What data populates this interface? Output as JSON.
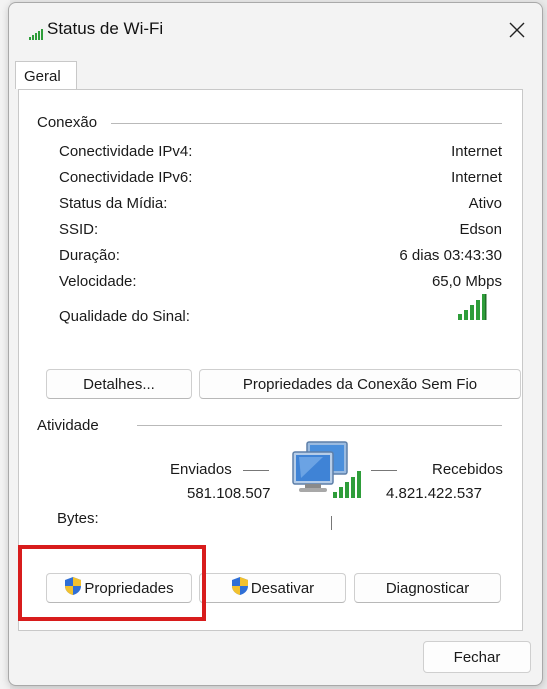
{
  "window": {
    "title": "Status de Wi-Fi",
    "tab": "Geral"
  },
  "connection": {
    "group_label": "Conexão",
    "rows": [
      {
        "label": "Conectividade IPv4:",
        "value": "Internet"
      },
      {
        "label": "Conectividade IPv6:",
        "value": "Internet"
      },
      {
        "label": "Status da Mídia:",
        "value": "Ativo"
      },
      {
        "label": "SSID:",
        "value": "Edson"
      },
      {
        "label": "Duração:",
        "value": "6 dias 03:43:30"
      },
      {
        "label": "Velocidade:",
        "value": "65,0 Mbps"
      }
    ],
    "signal_label": "Qualidade do Sinal:",
    "signal_bars": 5,
    "signal_bars_active": 5
  },
  "buttons": {
    "details": "Detalhes...",
    "wireless_properties": "Propriedades da Conexão Sem Fio",
    "properties": "Propriedades",
    "disable": "Desativar",
    "diagnose": "Diagnosticar",
    "close": "Fechar"
  },
  "activity": {
    "group_label": "Atividade",
    "sent_label": "Enviados",
    "received_label": "Recebidos",
    "bytes_label": "Bytes:",
    "sent_value": "581.108.507",
    "received_value": "4.821.422.537"
  },
  "colors": {
    "highlight": "#d81c1c",
    "signal": "#2e9d3a",
    "shield_blue": "#2f6fd6",
    "shield_yellow": "#f2c12e"
  }
}
